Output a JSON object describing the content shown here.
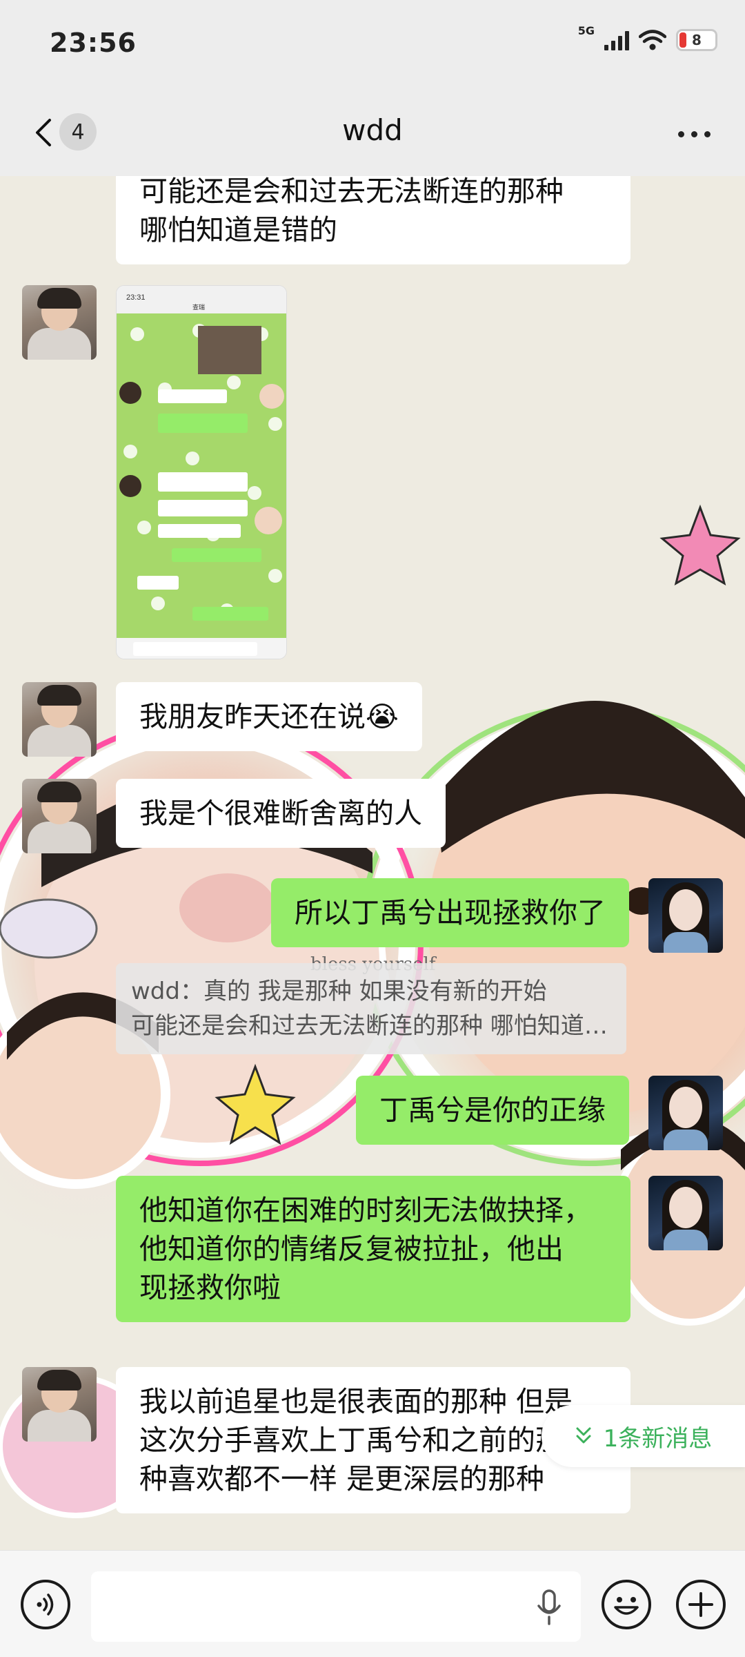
{
  "status_bar": {
    "time": "23:56",
    "network": "5G",
    "battery": "8"
  },
  "nav": {
    "unread_count": "4",
    "title": "wdd"
  },
  "messages": [
    {
      "line1": "可能还是会和过去无法断连的那种",
      "line2": "哪怕知道是错的"
    },
    {
      "text": "我朋友昨天还在说😭"
    },
    {
      "text": "我是个很难断舍离的人"
    },
    {
      "text": "所以丁禹兮出现拯救你了"
    },
    {
      "text": "丁禹兮是你的正缘"
    },
    {
      "line1": "他知道你在困难的时刻无法做抉择，",
      "line2": "他知道你的情绪反复被拉扯，他出",
      "line3": "现拯救你啦"
    },
    {
      "line1": "我以前追星也是很表面的那种 但是",
      "line2": "这次分手喜欢上丁禹兮和之前的那",
      "line3": "种喜欢都不一样 是更深层的那种"
    }
  ],
  "quote": {
    "line1": "wdd：真的 我是那种 如果没有新的开始",
    "line2": "可能还是会和过去无法断连的那种 哪怕知道是错的"
  },
  "screenshot_preview": {
    "time": "23:31",
    "title": "查瑞"
  },
  "new_message_label": "1条新消息",
  "colors": {
    "green_bubble": "#95ec69",
    "white_bubble": "#ffffff",
    "new_message": "#3bb15b"
  },
  "icons": [
    "back-icon",
    "more-icon",
    "voice-icon",
    "mic-icon",
    "emoji-icon",
    "plus-icon",
    "chevron-down-icon"
  ]
}
